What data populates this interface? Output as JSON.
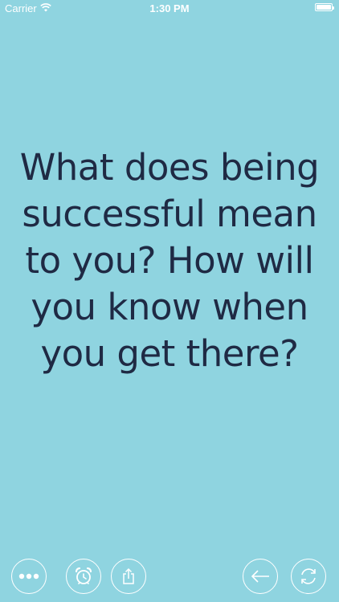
{
  "status_bar": {
    "carrier": "Carrier",
    "time": "1:30 PM",
    "wifi_icon": "wifi-icon",
    "battery_icon": "battery-icon"
  },
  "question": {
    "text": "What does being successful mean to you? How will you know when you get there?"
  },
  "toolbar": {
    "more_icon": "more-icon",
    "alarm_icon": "alarm-icon",
    "share_icon": "share-icon",
    "back_icon": "back-arrow-icon",
    "refresh_icon": "refresh-icon"
  },
  "colors": {
    "background": "#8fd4e0",
    "text": "#1f2a44",
    "icon": "#ffffff"
  }
}
